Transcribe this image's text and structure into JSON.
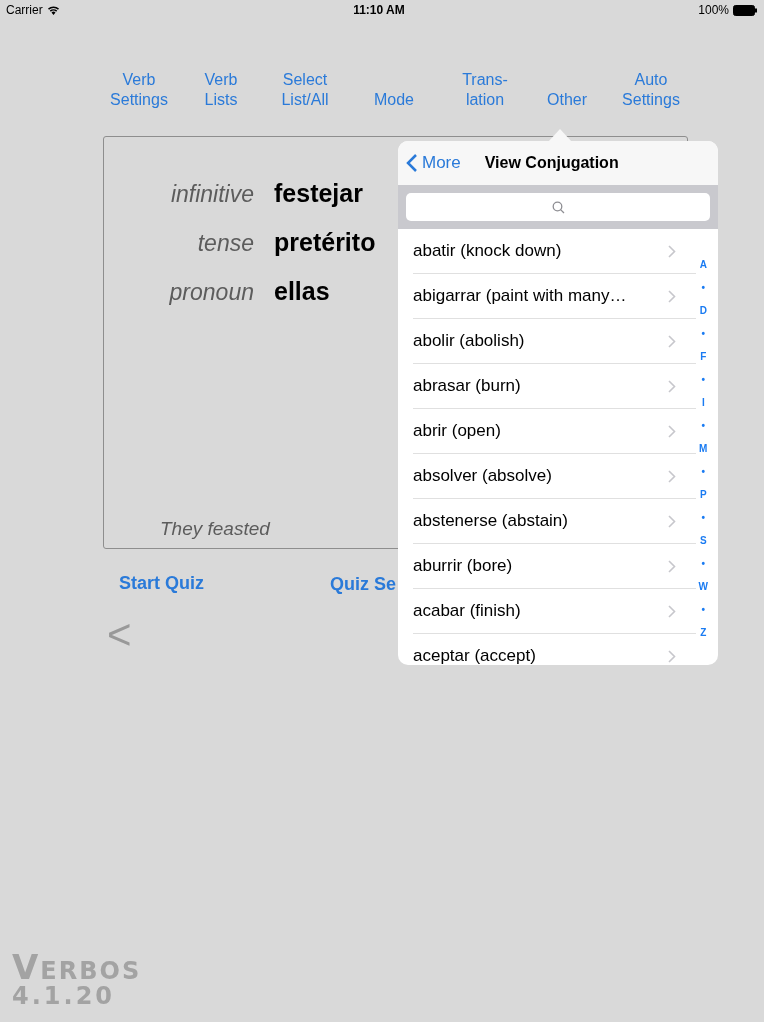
{
  "status_bar": {
    "carrier": "Carrier",
    "time": "11:10 AM",
    "battery": "100%"
  },
  "toolbar": [
    {
      "lines": [
        "Verb",
        "Settings"
      ]
    },
    {
      "lines": [
        "Verb",
        "Lists"
      ]
    },
    {
      "lines": [
        "Select",
        "List/All"
      ]
    },
    {
      "lines": [
        "Mode"
      ]
    },
    {
      "lines": [
        "Trans-",
        "lation"
      ]
    },
    {
      "lines": [
        "Other"
      ],
      "selected": true
    },
    {
      "lines": [
        "Auto",
        "Settings"
      ]
    }
  ],
  "card": {
    "fields": [
      {
        "label": "infinitive",
        "value": "festejar"
      },
      {
        "label": "tense",
        "value": "pretérito"
      },
      {
        "label": "pronoun",
        "value": "ellas"
      }
    ],
    "translation": "They feasted"
  },
  "actions": [
    "Start Quiz",
    "Quiz Se"
  ],
  "back": "<",
  "popover": {
    "back": "More",
    "title": "View Conjugation",
    "items": [
      "abatir (knock down)",
      "abigarrar (paint with many…",
      "abolir (abolish)",
      "abrasar (burn)",
      "abrir (open)",
      "absolver (absolve)",
      "abstenerse (abstain)",
      "aburrir (bore)",
      "acabar (finish)",
      "aceptar (accept)"
    ],
    "index": [
      "A",
      "•",
      "D",
      "•",
      "F",
      "•",
      "I",
      "•",
      "M",
      "•",
      "P",
      "•",
      "S",
      "•",
      "W",
      "•",
      "Z"
    ]
  },
  "logo": {
    "name": "VERBOS",
    "version": "4.1.20"
  }
}
